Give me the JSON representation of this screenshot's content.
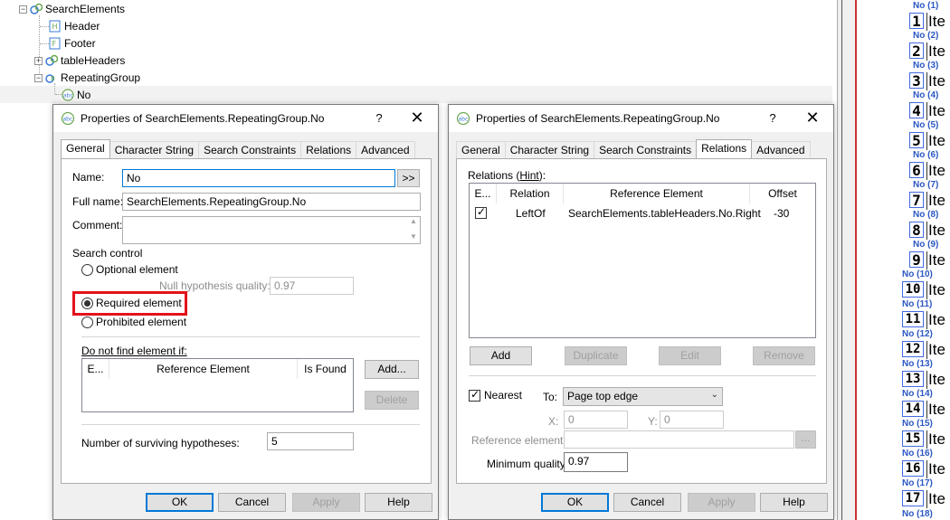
{
  "tree": {
    "nodes": [
      {
        "label": "SearchElements",
        "level": 0,
        "expander": "−",
        "icon": "repeating-icon"
      },
      {
        "label": "Header",
        "level": 1,
        "expander": "",
        "icon": "header-icon"
      },
      {
        "label": "Footer",
        "level": 1,
        "expander": "",
        "icon": "footer-icon"
      },
      {
        "label": "tableHeaders",
        "level": 1,
        "expander": "+",
        "icon": "repeating-icon"
      },
      {
        "label": "RepeatingGroup",
        "level": 1,
        "expander": "−",
        "icon": "repeating-group-icon"
      },
      {
        "label": "No",
        "level": 2,
        "expander": "",
        "icon": "string-element-icon"
      }
    ]
  },
  "dialog_left": {
    "title": "Properties of SearchElements.RepeatingGroup.No",
    "help": "?",
    "close": "✕",
    "tabs": [
      "General",
      "Character String",
      "Search Constraints",
      "Relations",
      "Advanced"
    ],
    "active_tab": "General",
    "name_label": "Name:",
    "name_value": "No",
    "name_more": ">>",
    "fullname_label": "Full name:",
    "fullname_value": "SearchElements.RepeatingGroup.No",
    "comment_label": "Comment:",
    "comment_value": "",
    "search_control_label": "Search control",
    "optional_label": "Optional element",
    "null_hyp_label": "Null hypothesis quality:",
    "null_hyp_value": "0.97",
    "required_label": "Required element",
    "prohibited_label": "Prohibited element",
    "selected_radio": "required",
    "do_not_find_label": "Do not find element if:",
    "dnf_columns": [
      "E...",
      "Reference Element",
      "Is Found"
    ],
    "add_label": "Add...",
    "delete_label": "Delete",
    "surviving_label": "Number of surviving hypotheses:",
    "surviving_value": "5",
    "ok": "OK",
    "cancel": "Cancel",
    "apply": "Apply",
    "helpbtn": "Help",
    "highlight_color": "#e3121b"
  },
  "dialog_right": {
    "title": "Properties of SearchElements.RepeatingGroup.No",
    "help": "?",
    "close": "✕",
    "tabs": [
      "General",
      "Character String",
      "Search Constraints",
      "Relations",
      "Advanced"
    ],
    "active_tab": "Relations",
    "relations_label": "Relations (",
    "hint_label": "Hint",
    "relations_label_end": "):",
    "columns": [
      "E...",
      "Relation",
      "Reference Element",
      "Offset"
    ],
    "rows": [
      {
        "enabled": true,
        "relation": "LeftOf",
        "reference": "SearchElements.tableHeaders.No.Right",
        "offset": "-30"
      }
    ],
    "add": "Add",
    "duplicate": "Duplicate",
    "edit": "Edit",
    "remove": "Remove",
    "nearest_label": "Nearest",
    "nearest_checked": true,
    "to_label": "To:",
    "to_value": "Page top edge",
    "x_label": "X:",
    "x_value": "0",
    "y_label": "Y:",
    "y_value": "0",
    "ref_label": "Reference element:",
    "ref_value": "",
    "ref_btn": "...",
    "minq_label": "Minimum quality:",
    "minq_value": "0.97",
    "ok": "OK",
    "cancel": "Cancel",
    "apply": "Apply",
    "helpbtn": "Help"
  },
  "strip": {
    "items": [
      {
        "no": "No (1)",
        "num": "1",
        "ite": "Ite"
      },
      {
        "no": "No (2)",
        "num": "2",
        "ite": "Ite"
      },
      {
        "no": "No (3)",
        "num": "3",
        "ite": "Ite"
      },
      {
        "no": "No (4)",
        "num": "4",
        "ite": "Ite"
      },
      {
        "no": "No (5)",
        "num": "5",
        "ite": "Ite"
      },
      {
        "no": "No (6)",
        "num": "6",
        "ite": "Ite"
      },
      {
        "no": "No (7)",
        "num": "7",
        "ite": "Ite"
      },
      {
        "no": "No (8)",
        "num": "8",
        "ite": "Ite"
      },
      {
        "no": "No (9)",
        "num": "9",
        "ite": "Ite"
      },
      {
        "no": "No (10)",
        "num": "10",
        "ite": "Ite"
      },
      {
        "no": "No (11)",
        "num": "11",
        "ite": "Ite"
      },
      {
        "no": "No (12)",
        "num": "12",
        "ite": "Ite"
      },
      {
        "no": "No (13)",
        "num": "13",
        "ite": "Ite"
      },
      {
        "no": "No (14)",
        "num": "14",
        "ite": "Ite"
      },
      {
        "no": "No (15)",
        "num": "15",
        "ite": "Ite"
      },
      {
        "no": "No (16)",
        "num": "16",
        "ite": "Ite"
      },
      {
        "no": "No (17)",
        "num": "17",
        "ite": "Ite"
      }
    ],
    "last_no": "No (18)"
  }
}
